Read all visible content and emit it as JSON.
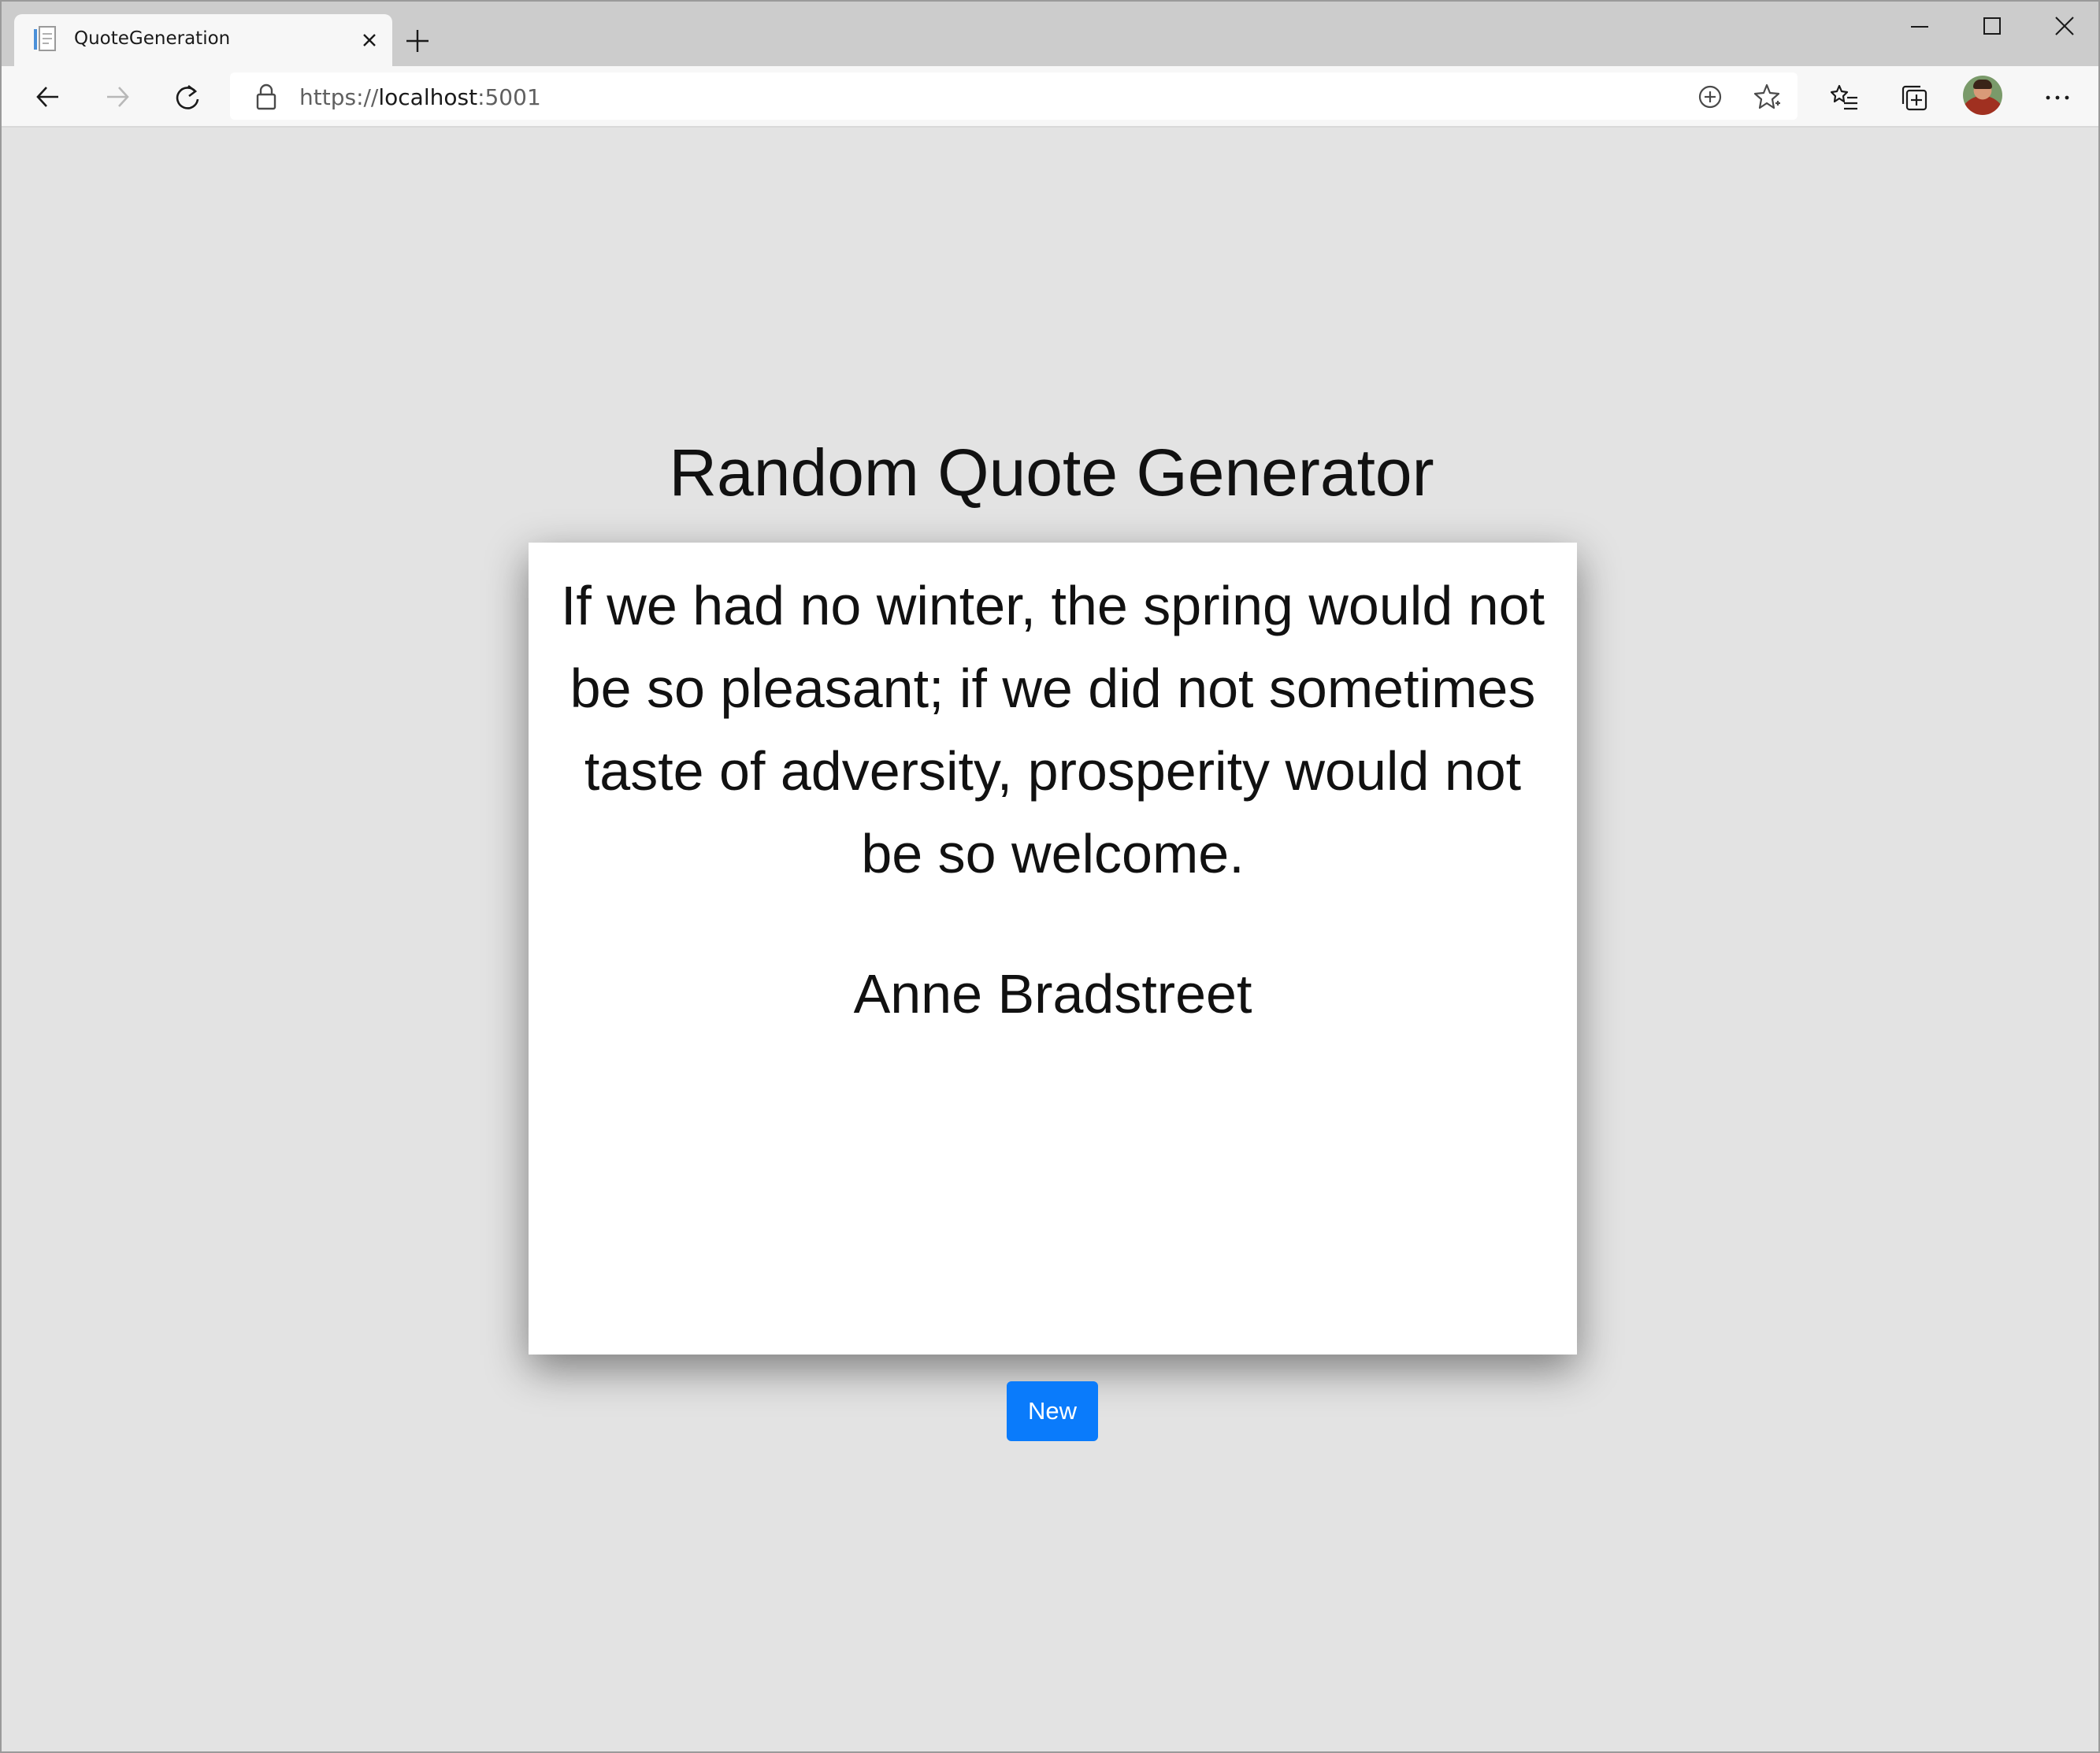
{
  "browser": {
    "tab": {
      "title": "QuoteGeneration",
      "favicon": "page-icon",
      "close_icon": "close-icon"
    },
    "new_tab_icon": "plus-icon",
    "window_controls": [
      "minimize-icon",
      "maximize-icon",
      "close-icon"
    ],
    "toolbar": {
      "back_icon": "back-arrow-icon",
      "forward_icon": "forward-arrow-icon",
      "refresh_icon": "refresh-icon",
      "address": {
        "lock_icon": "lock-icon",
        "scheme": "https://",
        "host": "localhost",
        "port": ":5001",
        "add_icon": "add-circle-icon",
        "favorite_icon": "star-add-icon"
      },
      "favorites_icon": "favorites-list-icon",
      "collections_icon": "collections-icon",
      "profile_icon": "avatar",
      "menu_icon": "more-dots-icon"
    }
  },
  "page": {
    "title": "Random Quote Generator",
    "quote": {
      "text": "If we had no winter, the spring would not be so pleasant; if we did not sometimes taste of adversity, prosperity would not be so welcome.",
      "author": "Anne Bradstreet"
    },
    "new_button_label": "New",
    "colors": {
      "background": "#e3e3e3",
      "card": "#ffffff",
      "button": "#0a7bfb",
      "button_text": "#ffffff"
    }
  }
}
